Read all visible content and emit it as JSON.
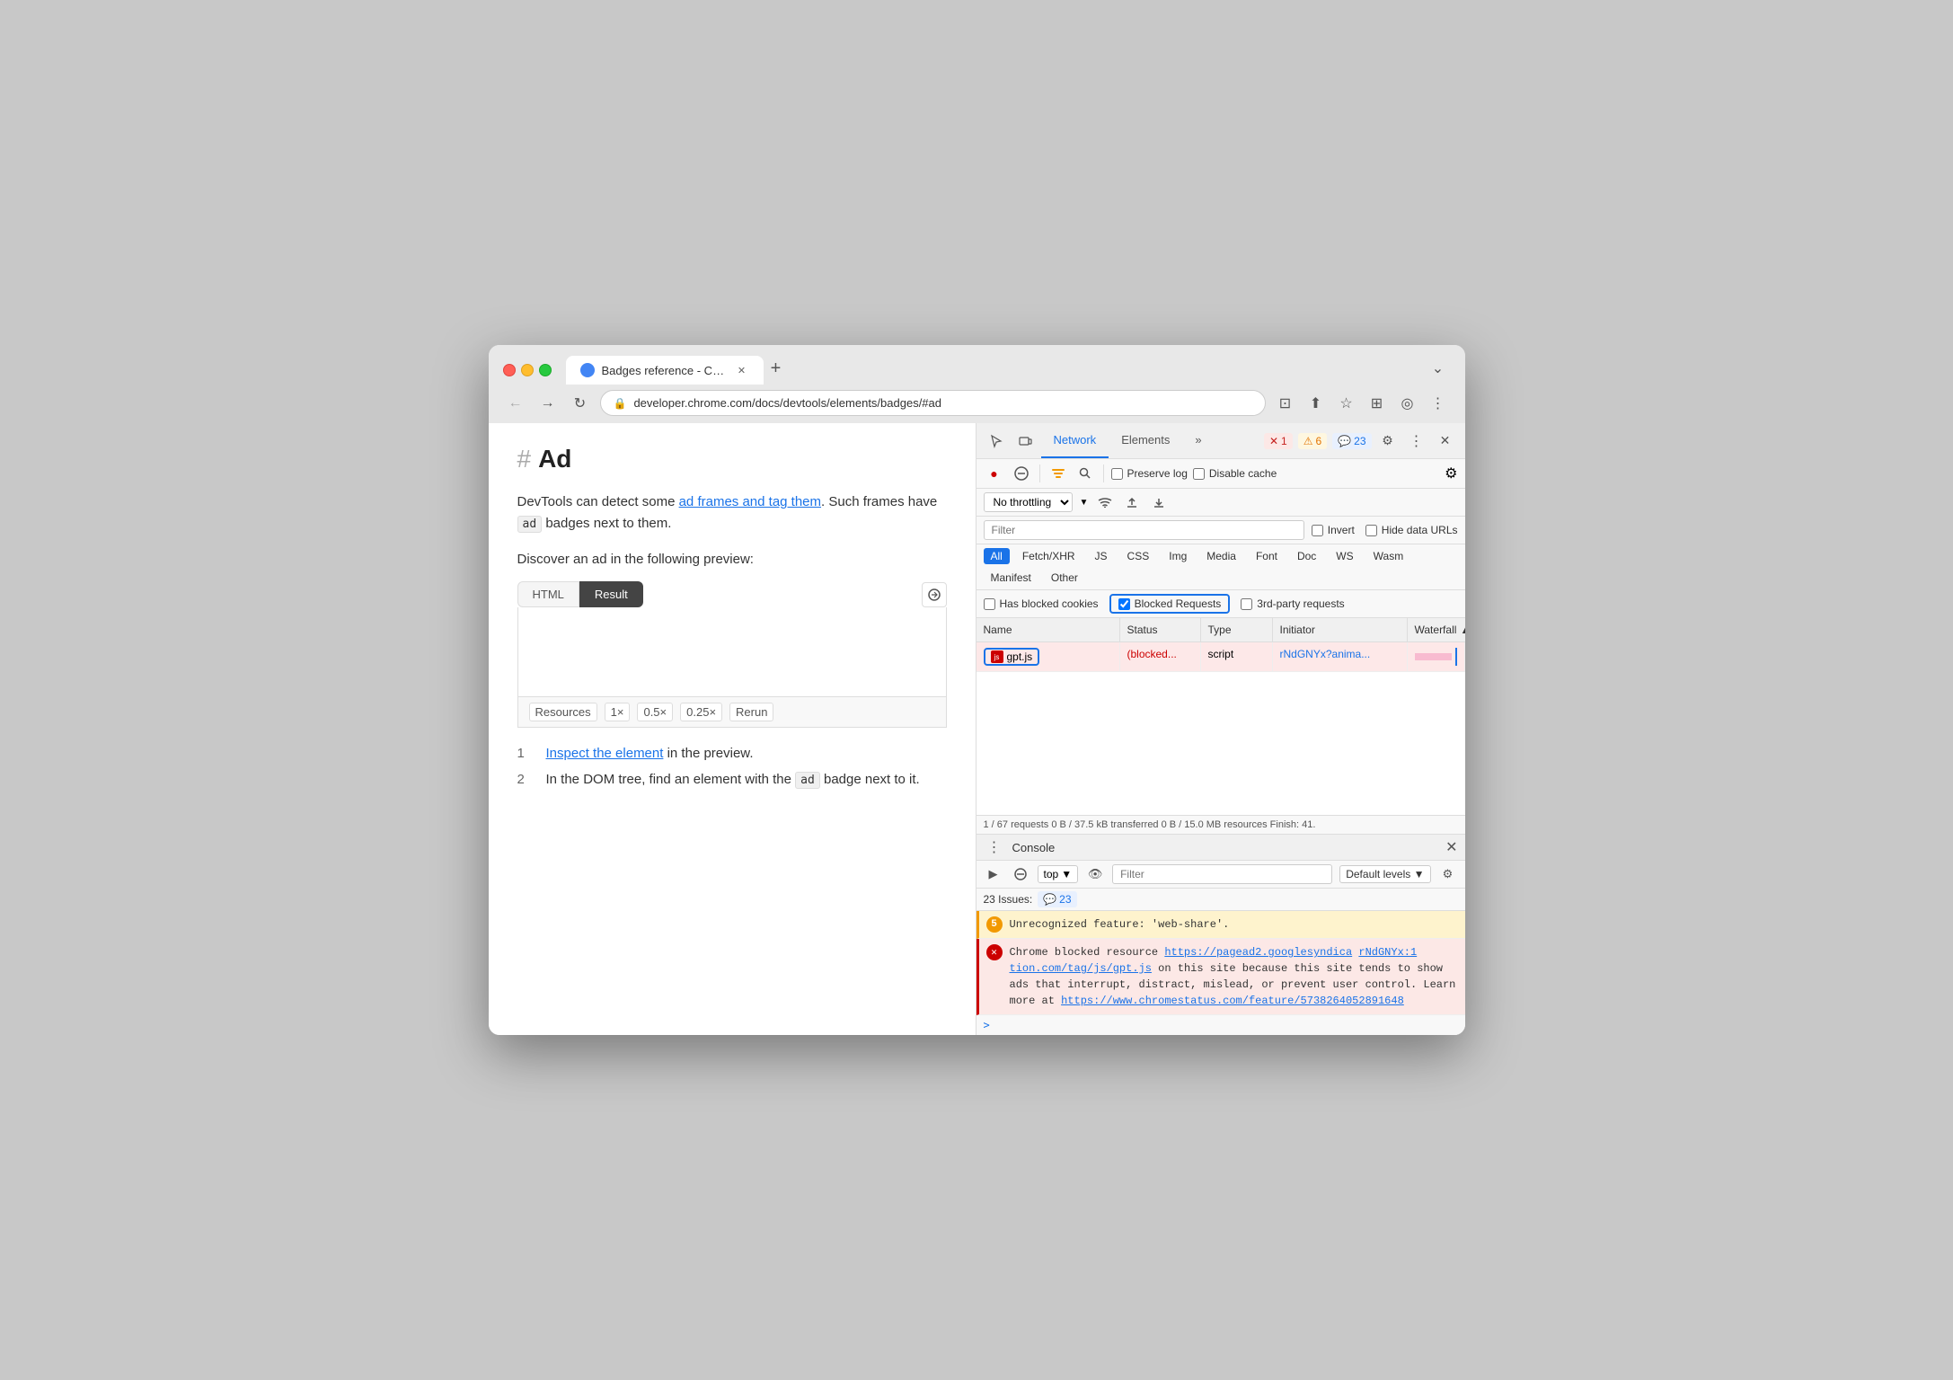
{
  "browser": {
    "tab_title": "Badges reference - Chrome De",
    "url": "developer.chrome.com/docs/devtools/elements/badges/#ad",
    "new_tab_label": "+",
    "chevron_down": "⌄"
  },
  "page": {
    "hash_symbol": "#",
    "heading": "Ad",
    "paragraph1_pre": "DevTools can detect some ",
    "paragraph1_link1": "ad frames and tag them",
    "paragraph1_post": ". Such frames have",
    "paragraph1_badge": "ad",
    "paragraph1_end": "badges next to them.",
    "paragraph2": "Discover an ad in the following preview:",
    "preview_tab_html": "HTML",
    "preview_tab_result": "Result",
    "preview_footer_resources": "Resources",
    "preview_footer_1x": "1×",
    "preview_footer_05x": "0.5×",
    "preview_footer_025x": "0.25×",
    "preview_footer_rerun": "Rerun",
    "step1_num": "1",
    "step1_link": "Inspect the element",
    "step1_text": "in the preview.",
    "step2_num": "2",
    "step2_text1": "In the DOM tree, find an element with the",
    "step2_badge": "ad",
    "step2_text2": "badge next to it."
  },
  "devtools": {
    "tool_icons": {
      "cursor": "⬡",
      "responsive": "◻"
    },
    "tabs": [
      "Network",
      "Elements"
    ],
    "active_tab": "Network",
    "more_tabs": "»",
    "badge_error_icon": "✕",
    "badge_error_count": "1",
    "badge_warning_icon": "⚠",
    "badge_warning_count": "6",
    "badge_info_icon": "💬",
    "badge_info_count": "23",
    "settings_icon": "⚙",
    "more_icon": "⋮",
    "close_icon": "✕"
  },
  "network": {
    "record_btn_title": "●",
    "clear_btn_title": "🚫",
    "filter_icon": "🔽",
    "search_icon": "🔍",
    "preserve_log_label": "Preserve log",
    "disable_cache_label": "Disable cache",
    "settings_icon": "⚙",
    "throttle_label": "No throttling",
    "wifi_icon": "📶",
    "upload_icon": "⬆",
    "download_icon": "⬇",
    "filter_placeholder": "Filter",
    "invert_label": "Invert",
    "hide_data_urls_label": "Hide data URLs",
    "type_filters": [
      "All",
      "Fetch/XHR",
      "JS",
      "CSS",
      "Img",
      "Media",
      "Font",
      "Doc",
      "WS",
      "Wasm",
      "Manifest",
      "Other"
    ],
    "active_type": "All",
    "has_blocked_cookies_label": "Has blocked cookies",
    "blocked_requests_label": "Blocked Requests",
    "third_party_label": "3rd-party requests",
    "table_headers": {
      "name": "Name",
      "status": "Status",
      "type": "Type",
      "initiator": "Initiator",
      "waterfall": "Waterfall"
    },
    "row": {
      "name": "gpt.js",
      "status": "(blocked...",
      "type": "script",
      "initiator": "rNdGNYx?anima...",
      "waterfall": ""
    },
    "status_bar": "1 / 67 requests   0 B / 37.5 kB transferred   0 B / 15.0 MB resources   Finish: 41."
  },
  "console": {
    "title": "Console",
    "close_icon": "✕",
    "run_icon": "▶",
    "block_icon": "🚫",
    "top_label": "top",
    "eye_icon": "👁",
    "filter_placeholder": "Filter",
    "default_levels_label": "Default levels",
    "settings_icon": "⚙",
    "issues_label": "23 Issues:",
    "issues_icon": "💬",
    "issues_count": "23",
    "warning_count": "5",
    "warning_msg": "Unrecognized feature: 'web-share'.",
    "error_msg_pre": "Chrome blocked resource ",
    "error_link1": "https://pagead2.googlesyndica",
    "error_link2": "rNdGNYx:1",
    "error_msg_domain": "tion.com/tag/js/gpt.js",
    "error_msg_body": " on this site because this site tends to show ads that interrupt, distract, mislead, or prevent user control. Learn more at ",
    "error_link3": "https://www.chromestatus.com/feature/5738264052891648",
    "caret": ">"
  }
}
